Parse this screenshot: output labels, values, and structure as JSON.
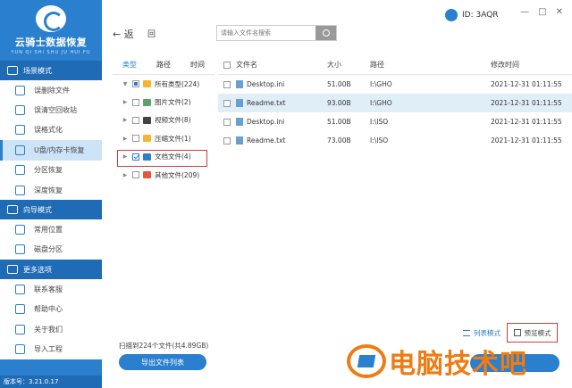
{
  "app": {
    "title": "云骑士数据恢复",
    "subtitle": "YUN QI SHI SHU JU HUI FU",
    "version": "版本号：3.21.0.17"
  },
  "sidebar": {
    "sections": [
      {
        "title": "场景模式",
        "items": [
          {
            "label": "误删除文件",
            "icon": "trash-icon"
          },
          {
            "label": "误清空回收站",
            "icon": "recycle-bin-icon"
          },
          {
            "label": "误格式化",
            "icon": "format-icon"
          },
          {
            "label": "U盘/内存卡恢复",
            "icon": "usb-icon",
            "active": true
          },
          {
            "label": "分区恢复",
            "icon": "partition-icon"
          },
          {
            "label": "深度恢复",
            "icon": "deep-scan-icon"
          }
        ]
      },
      {
        "title": "向导模式",
        "items": [
          {
            "label": "常用位置",
            "icon": "location-icon"
          },
          {
            "label": "磁盘分区",
            "icon": "disk-icon"
          }
        ]
      },
      {
        "title": "更多选项",
        "items": [
          {
            "label": "联系客服",
            "icon": "support-icon"
          },
          {
            "label": "帮助中心",
            "icon": "help-icon"
          },
          {
            "label": "关于我们",
            "icon": "info-icon"
          },
          {
            "label": "导入工程",
            "icon": "import-icon"
          }
        ]
      }
    ]
  },
  "topbar": {
    "back_label": "返",
    "home_label": "回",
    "search_placeholder": "请输入文件名搜索",
    "user_id": "ID: 3AQR",
    "win_min": "—",
    "win_restore": "□",
    "win_close": "✕"
  },
  "tree": {
    "tabs": [
      "类型",
      "路径",
      "时间"
    ],
    "rows": [
      {
        "label": "所有类型(224)",
        "arrow": "▼",
        "check": "partial",
        "color": "#f2b632",
        "level": 0
      },
      {
        "label": "图片文件(2)",
        "arrow": "▶",
        "check": "none",
        "color": "#5aa469",
        "level": 1
      },
      {
        "label": "视频文件(8)",
        "arrow": "▶",
        "check": "none",
        "color": "#444444",
        "level": 1
      },
      {
        "label": "压缩文件(1)",
        "arrow": "▶",
        "check": "none",
        "color": "#f2b632",
        "level": 1
      },
      {
        "label": "文档文件(4)",
        "arrow": "▶",
        "check": "checked",
        "color": "#2a7fce",
        "level": 1
      },
      {
        "label": "其他文件(209)",
        "arrow": "▶",
        "check": "none",
        "color": "#e8553e",
        "level": 1
      }
    ]
  },
  "table": {
    "headers": {
      "name": "文件名",
      "size": "大小",
      "path": "路径",
      "time": "修改时间"
    },
    "rows": [
      {
        "name": "Desktop.ini",
        "size": "51.00B",
        "path": "I:\\GHO",
        "time": "2021-12-31 01:11:55"
      },
      {
        "name": "Readme.txt",
        "size": "93.00B",
        "path": "I:\\GHO",
        "time": "2021-12-31 01:11:55"
      },
      {
        "name": "Desktop.ini",
        "size": "51.00B",
        "path": "I:\\ISO",
        "time": "2021-12-31 01:11:55"
      },
      {
        "name": "Readme.txt",
        "size": "73.00B",
        "path": "I:\\ISO",
        "time": "2021-12-31 01:11:55"
      }
    ]
  },
  "footer": {
    "scan_info": "扫描到224个文件(共4.89GB)",
    "export_label": "导出文件列表",
    "list_mode": "列表模式",
    "preview_mode": "预览模式"
  },
  "watermark": {
    "text": "电脑技术吧"
  }
}
